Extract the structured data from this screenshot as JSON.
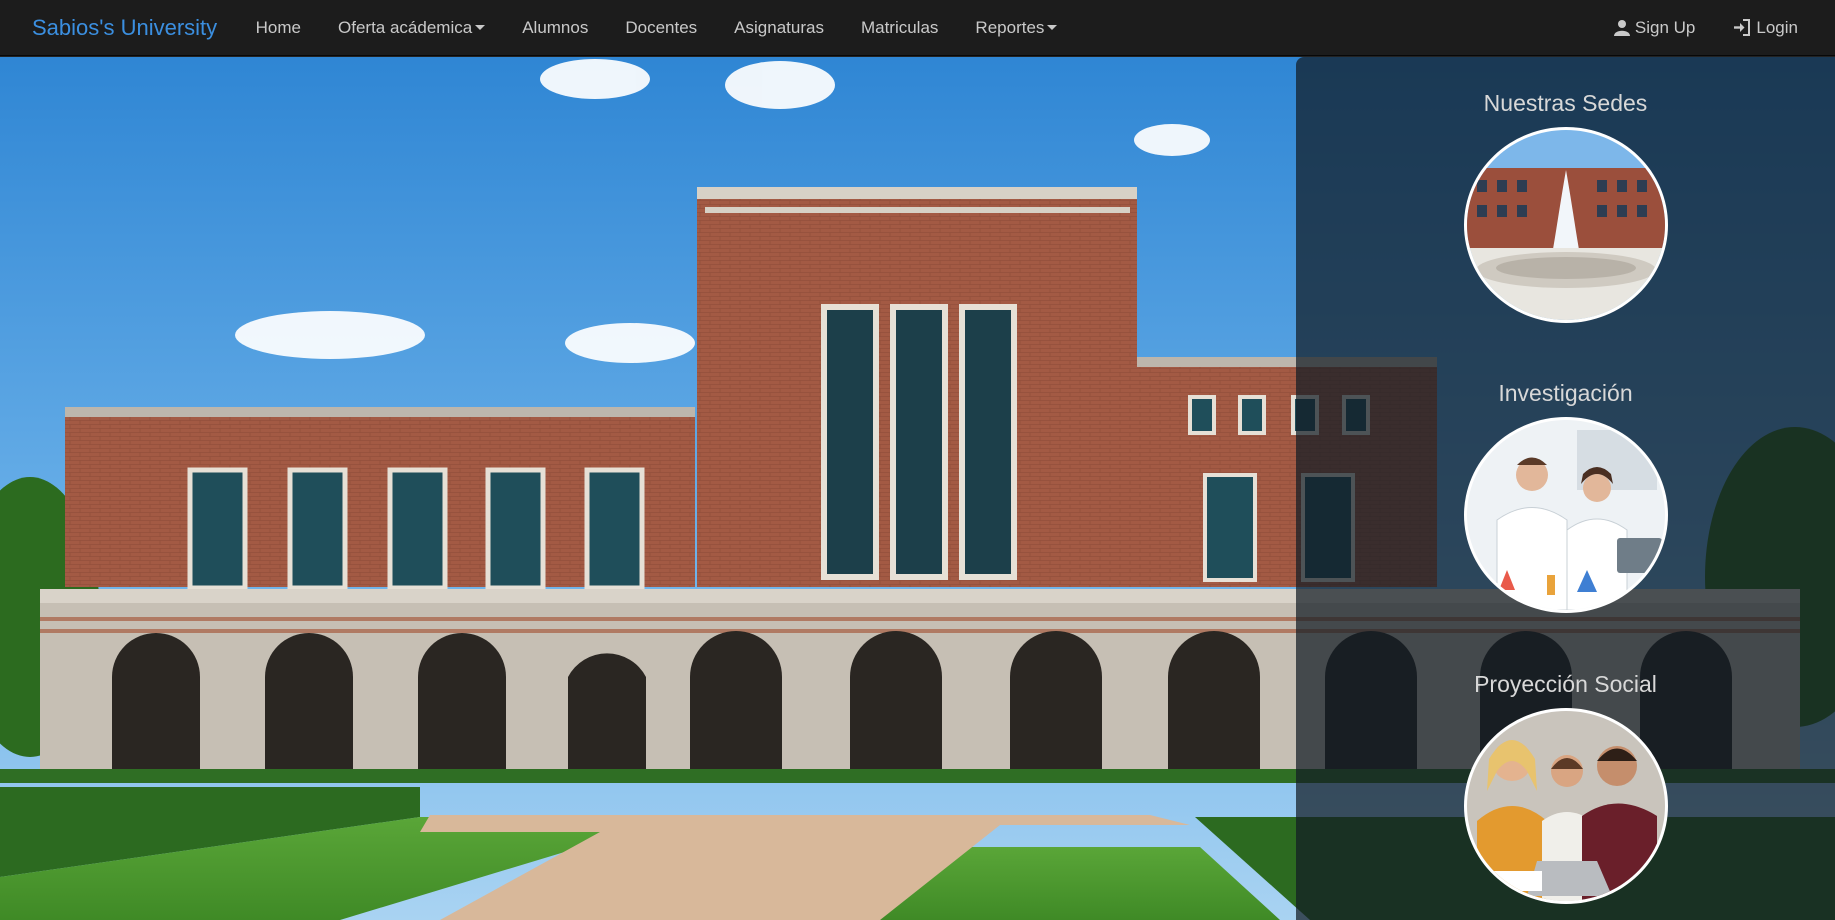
{
  "navbar": {
    "brand": "Sabios's University",
    "items": [
      {
        "label": "Home",
        "dropdown": false
      },
      {
        "label": "Oferta acádemica",
        "dropdown": true
      },
      {
        "label": "Alumnos",
        "dropdown": false
      },
      {
        "label": "Docentes",
        "dropdown": false
      },
      {
        "label": "Asignaturas",
        "dropdown": false
      },
      {
        "label": "Matriculas",
        "dropdown": false
      },
      {
        "label": "Reportes",
        "dropdown": true
      }
    ],
    "right": {
      "signup_label": "Sign Up",
      "signup_icon": "user-icon",
      "login_label": "Login",
      "login_icon": "login-icon"
    }
  },
  "hero": {
    "image": "university-building-photo"
  },
  "panel": {
    "sections": [
      {
        "title": "Nuestras Sedes",
        "image": "campus-fountain-photo"
      },
      {
        "title": "Investigación",
        "image": "lab-researchers-photo"
      },
      {
        "title": "Proyección Social",
        "image": "students-laptop-photo"
      }
    ]
  },
  "colors": {
    "navbar_bg": "#1c1c1c",
    "brand": "#3b8fe0",
    "nav_text": "#c9c9c9",
    "panel_bg": "rgba(18,28,36,0.72)"
  }
}
